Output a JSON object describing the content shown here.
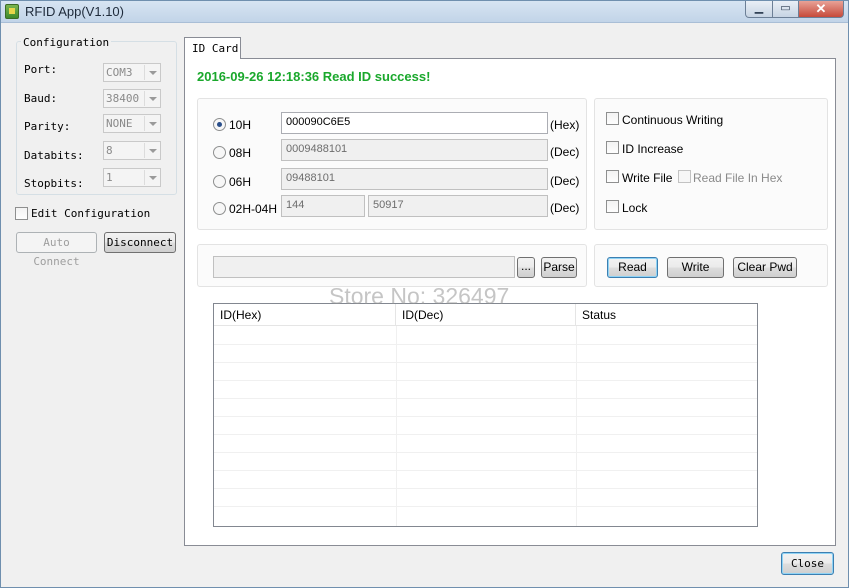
{
  "window": {
    "title": "RFID App(V1.10)",
    "min_glyph": "▁",
    "max_glyph": "▭",
    "close_glyph": "✕"
  },
  "configuration": {
    "label": "Configuration",
    "fields": [
      {
        "label": "Port:",
        "value": "COM3"
      },
      {
        "label": "Baud:",
        "value": "38400"
      },
      {
        "label": "Parity:",
        "value": "NONE"
      },
      {
        "label": "Databits:",
        "value": "8"
      },
      {
        "label": "Stopbits:",
        "value": "1"
      }
    ],
    "edit_config_label": "Edit Configuration",
    "auto_connect_label": "Auto Connect",
    "disconnect_label": "Disconnect"
  },
  "tab": {
    "label": "ID Card"
  },
  "status_message": "2016-09-26 12:18:36  Read ID success!",
  "id_formats": [
    {
      "label": "10H",
      "checked": true,
      "values": [
        "000090C6E5"
      ],
      "suffix": "(Hex)"
    },
    {
      "label": "08H",
      "checked": false,
      "values": [
        "0009488101"
      ],
      "suffix": "(Dec)"
    },
    {
      "label": "06H",
      "checked": false,
      "values": [
        "09488101"
      ],
      "suffix": "(Dec)"
    },
    {
      "label": "02H-04H",
      "checked": false,
      "values": [
        "144",
        "50917"
      ],
      "suffix": "(Dec)"
    }
  ],
  "options": {
    "continuous_writing": "Continuous Writing",
    "id_increase": "ID Increase",
    "write_file": "Write File",
    "read_file_in_hex": "Read File In Hex",
    "lock": "Lock"
  },
  "file": {
    "path_value": "",
    "browse_label": "...",
    "parse_label": "Parse"
  },
  "actions": {
    "read": "Read",
    "write": "Write",
    "clear_pwd": "Clear Pwd"
  },
  "table": {
    "columns": [
      "ID(Hex)",
      "ID(Dec)",
      "Status"
    ],
    "rows": []
  },
  "watermark": "Store No: 326497",
  "close_label": "Close"
}
